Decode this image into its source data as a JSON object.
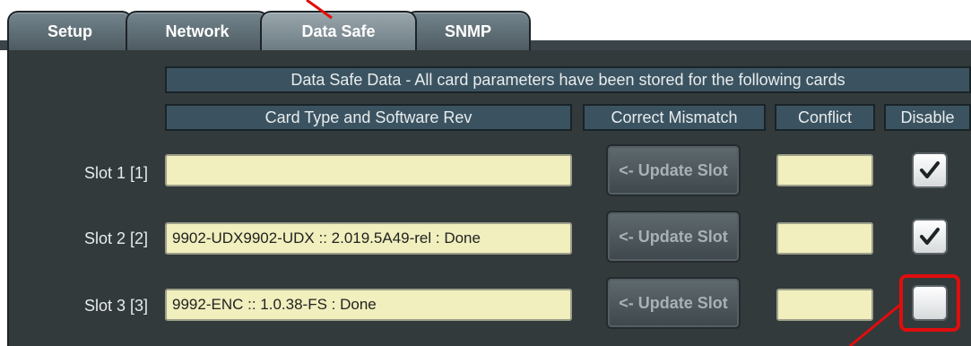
{
  "tabs": [
    {
      "label": "Setup",
      "active": false
    },
    {
      "label": "Network",
      "active": false
    },
    {
      "label": "Data Safe",
      "active": true
    },
    {
      "label": "SNMP",
      "active": false
    }
  ],
  "banner": "Data Safe Data - All card parameters have been stored for the following cards",
  "columns": {
    "card_type": "Card Type and Software Rev",
    "correct_mismatch": "Correct Mismatch",
    "conflict": "Conflict",
    "disable": "Disable"
  },
  "slots": [
    {
      "label": "Slot 1 [1]",
      "card": "",
      "button": "<- Update Slot",
      "disabled": true
    },
    {
      "label": "Slot 2 [2]",
      "card": "9902-UDX9902-UDX :: 2.019.5A49-rel : Done",
      "button": "<- Update Slot",
      "disabled": true
    },
    {
      "label": "Slot 3 [3]",
      "card": "9992-ENC :: 1.0.38-FS : Done",
      "button": "<- Update Slot",
      "disabled": false
    }
  ],
  "colors": {
    "highlight": "#e10d0d",
    "panel": "#323a3c",
    "header": "#3b5360",
    "field": "#f0efbd"
  }
}
